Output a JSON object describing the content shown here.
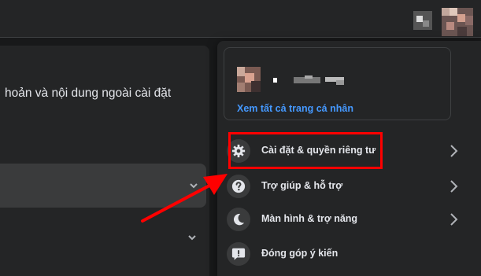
{
  "left_panel": {
    "description_text": "hoản và nội dung ngoài cài đặt"
  },
  "profile": {
    "see_all_link": "Xem tất cả trang cá nhân"
  },
  "menu": {
    "items": [
      {
        "label": "Cài đặt & quyền riêng tư",
        "icon": "gear-icon",
        "has_chevron": true
      },
      {
        "label": "Trợ giúp & hỗ trợ",
        "icon": "help-icon",
        "has_chevron": true
      },
      {
        "label": "Màn hình & trợ năng",
        "icon": "moon-icon",
        "has_chevron": true
      },
      {
        "label": "Đóng góp ý kiến",
        "icon": "feedback-icon",
        "has_chevron": false
      }
    ]
  },
  "colors": {
    "background": "#18191a",
    "surface": "#242526",
    "hover": "#3a3b3c",
    "link": "#4599ff",
    "annotation": "#ff0000"
  }
}
